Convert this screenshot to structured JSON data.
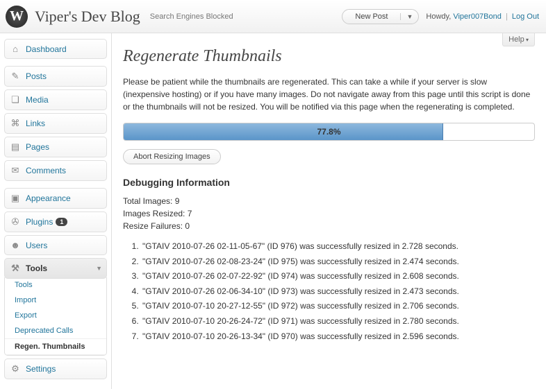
{
  "header": {
    "site_title": "Viper's Dev Blog",
    "search_blocked": "Search Engines Blocked",
    "new_post": "New Post",
    "howdy": "Howdy,",
    "username": "Viper007Bond",
    "logout": "Log Out"
  },
  "sidebar": {
    "dashboard": "Dashboard",
    "posts": "Posts",
    "media": "Media",
    "links": "Links",
    "pages": "Pages",
    "comments": "Comments",
    "appearance": "Appearance",
    "plugins": "Plugins",
    "plugins_badge": "1",
    "users": "Users",
    "tools": "Tools",
    "settings": "Settings",
    "submenu": {
      "tools": "Tools",
      "import": "Import",
      "export": "Export",
      "deprecated": "Deprecated Calls",
      "regen": "Regen. Thumbnails"
    }
  },
  "page": {
    "help": "Help",
    "title": "Regenerate Thumbnails",
    "intro": "Please be patient while the thumbnails are regenerated. This can take a while if your server is slow (inexpensive hosting) or if you have many images. Do not navigate away from this page until this script is done or the thumbnails will not be resized. You will be notified via this page when the regenerating is completed.",
    "progress_percent": "77.8%",
    "progress_width": "77.8%",
    "abort": "Abort Resizing Images",
    "debug_title": "Debugging Information",
    "stats": {
      "total_label": "Total Images:",
      "total_value": "9",
      "resized_label": "Images Resized:",
      "resized_value": "7",
      "failures_label": "Resize Failures:",
      "failures_value": "0"
    },
    "log": [
      "\"GTAIV 2010-07-26 02-11-05-67\" (ID 976) was successfully resized in 2.728 seconds.",
      "\"GTAIV 2010-07-26 02-08-23-24\" (ID 975) was successfully resized in 2.474 seconds.",
      "\"GTAIV 2010-07-26 02-07-22-92\" (ID 974) was successfully resized in 2.608 seconds.",
      "\"GTAIV 2010-07-26 02-06-34-10\" (ID 973) was successfully resized in 2.473 seconds.",
      "\"GTAIV 2010-07-10 20-27-12-55\" (ID 972) was successfully resized in 2.706 seconds.",
      "\"GTAIV 2010-07-10 20-26-24-72\" (ID 971) was successfully resized in 2.780 seconds.",
      "\"GTAIV 2010-07-10 20-26-13-34\" (ID 970) was successfully resized in 2.596 seconds."
    ]
  }
}
